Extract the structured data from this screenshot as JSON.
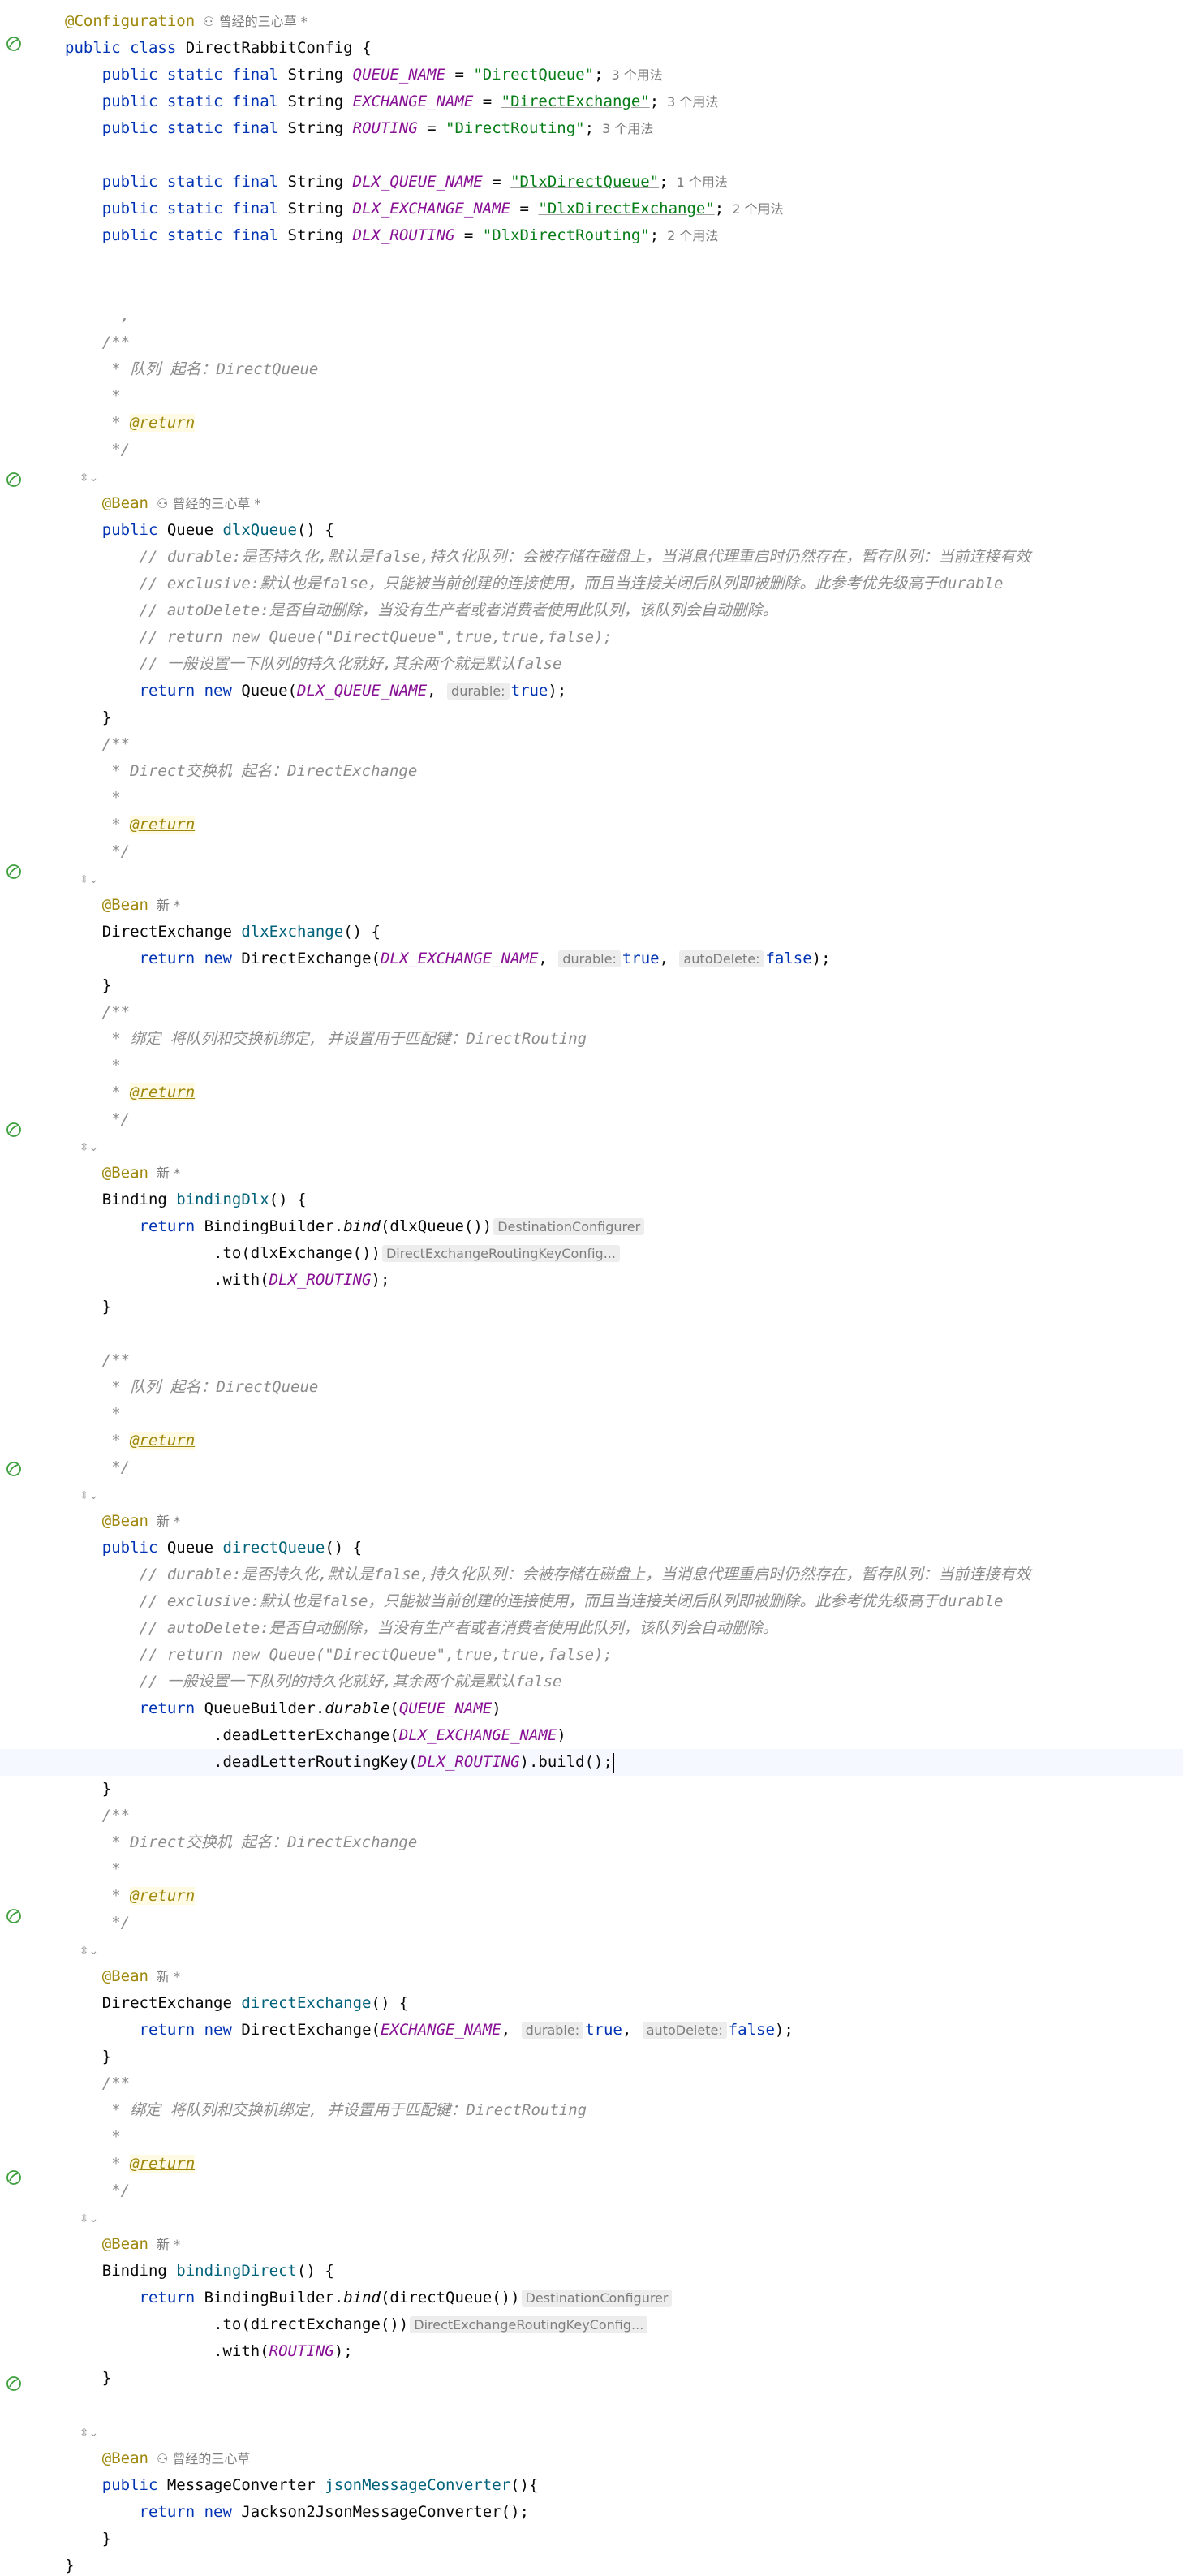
{
  "editor": {
    "file_class": "DirectRabbitConfig",
    "author_label": "曾经的三心草",
    "new_label": "新",
    "usages": {
      "three": "3 个用法",
      "one": "1 个用法",
      "two": "2 个用法"
    },
    "hints": {
      "durable": "durable:",
      "autoDelete": "autoDelete:",
      "destination": "DestinationConfigurer",
      "routingkey": "DirectExchangeRoutingKeyConfig..."
    },
    "constants": {
      "queue_name_value": "\"DirectQueue\"",
      "exchange_name_value": "\"DirectExchange\"",
      "routing_value": "\"DirectRouting\"",
      "dlx_queue_value": "\"DlxDirectQueue\"",
      "dlx_exchange_value": "\"DlxDirectExchange\"",
      "dlx_routing_value": "\"DlxDirectRouting\""
    },
    "docs": {
      "queue": "* 队列 起名：DirectQueue",
      "exchange": "* Direct交换机 起名：DirectExchange",
      "binding": "* 绑定 将队列和交换机绑定, 并设置用于匹配键：DirectRouting"
    },
    "comments": {
      "durable": "// durable:是否持久化,默认是false,持久化队列：会被存储在磁盘上，当消息代理重启时仍然存在，暂存队列：当前连接有效",
      "exclusive": "// exclusive:默认也是false，只能被当前创建的连接使用，而且当连接关闭后队列即被删除。此参考优先级高于durable",
      "autoDelete": "// autoDelete:是否自动删除，当没有生产者或者消费者使用此队列，该队列会自动删除。",
      "return_new": "// return new Queue(\"DirectQueue\",true,true,false);",
      "general": "// 一般设置一下队列的持久化就好,其余两个就是默认false"
    }
  }
}
